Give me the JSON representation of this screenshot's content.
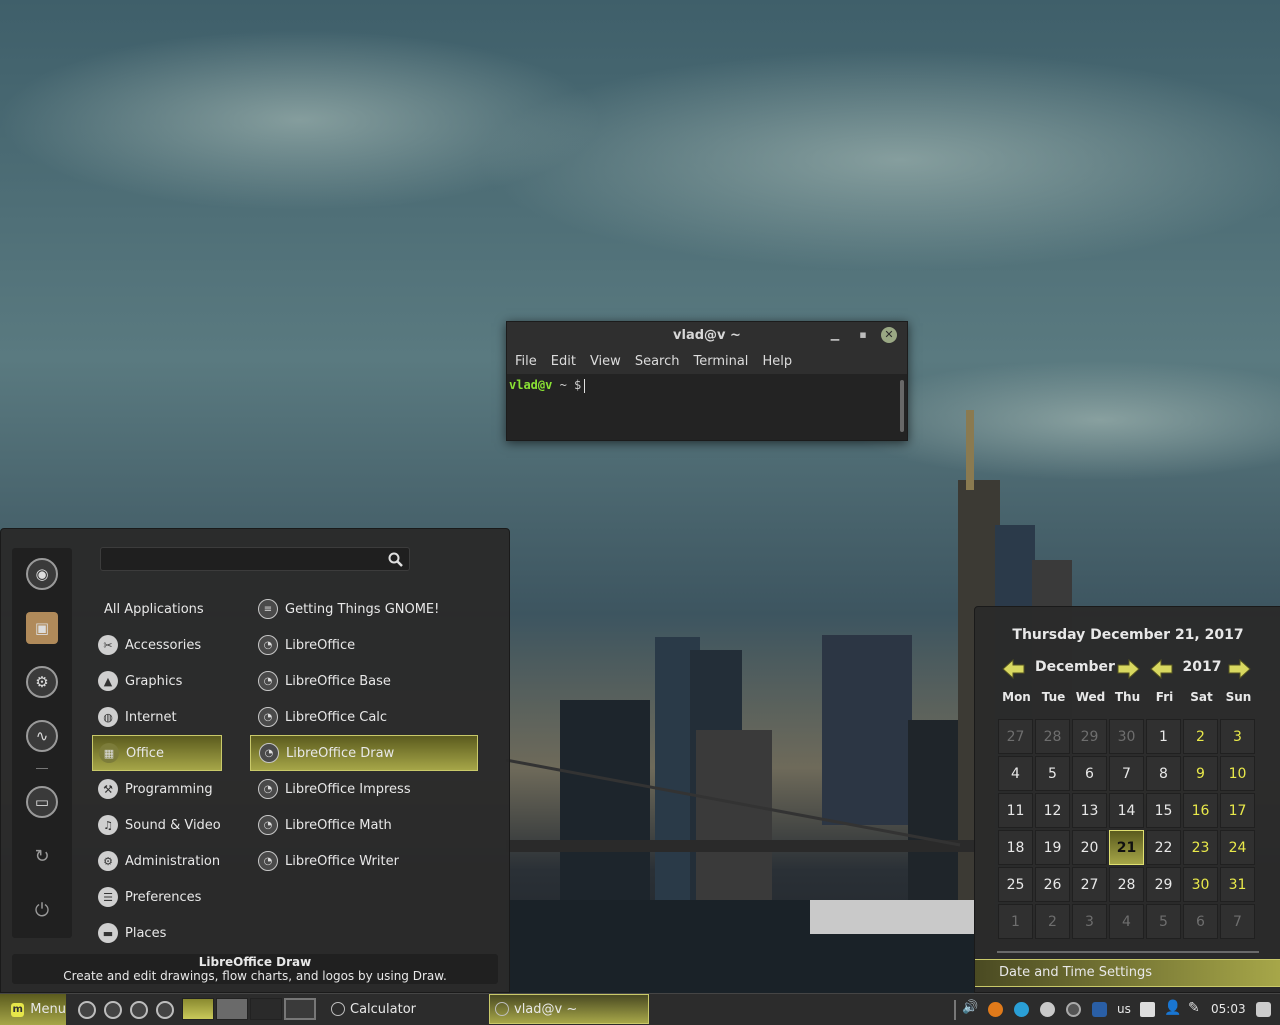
{
  "terminal": {
    "title": "vlad@v ~",
    "menu": [
      "File",
      "Edit",
      "View",
      "Search",
      "Terminal",
      "Help"
    ],
    "prompt_user": "vlad@v",
    "prompt_rest": " ~ $"
  },
  "menu": {
    "search_value": "",
    "categories": [
      "All Applications",
      "Accessories",
      "Graphics",
      "Internet",
      "Office",
      "Programming",
      "Sound & Video",
      "Administration",
      "Preferences",
      "Places"
    ],
    "selected_category": "Office",
    "apps": [
      "Getting Things GNOME!",
      "LibreOffice",
      "LibreOffice Base",
      "LibreOffice Calc",
      "LibreOffice Draw",
      "LibreOffice Impress",
      "LibreOffice Math",
      "LibreOffice Writer"
    ],
    "selected_app": "LibreOffice Draw",
    "description_title": "LibreOffice Draw",
    "description_text": "Create and edit drawings, flow charts, and logos by using Draw."
  },
  "calendar": {
    "full_date": "Thursday December 21, 2017",
    "month": "December",
    "year": "2017",
    "weekdays": [
      "Mon",
      "Tue",
      "Wed",
      "Thu",
      "Fri",
      "Sat",
      "Sun"
    ],
    "weeks": [
      [
        "27",
        "28",
        "29",
        "30",
        "1",
        "2",
        "3"
      ],
      [
        "4",
        "5",
        "6",
        "7",
        "8",
        "9",
        "10"
      ],
      [
        "11",
        "12",
        "13",
        "14",
        "15",
        "16",
        "17"
      ],
      [
        "18",
        "19",
        "20",
        "21",
        "22",
        "23",
        "24"
      ],
      [
        "25",
        "26",
        "27",
        "28",
        "29",
        "30",
        "31"
      ],
      [
        "1",
        "2",
        "3",
        "4",
        "5",
        "6",
        "7"
      ]
    ],
    "today": "21",
    "settings_label": "Date and Time Settings"
  },
  "panel": {
    "menu_label": "Menu",
    "tasks": [
      "Calculator",
      "vlad@v ~"
    ],
    "keyboard_layout": "us",
    "clock": "05:03"
  },
  "colors": {
    "accent": "#a6a648",
    "weekend": "#e9e94a",
    "prompt": "#8ae234"
  }
}
